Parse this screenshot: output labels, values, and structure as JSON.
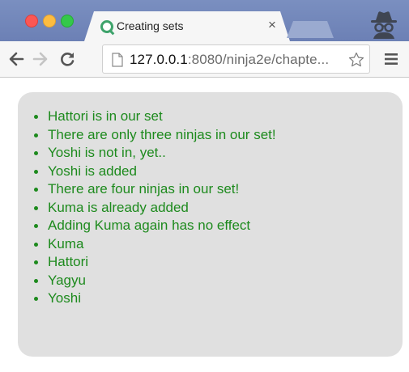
{
  "browser": {
    "tab": {
      "title": "Creating sets",
      "close_glyph": "×",
      "favicon": "loading-spinner-icon"
    },
    "url": {
      "host": "127.0.0.1",
      "rest": ":8080/ninja2e/chapte..."
    }
  },
  "page": {
    "results": [
      "Hattori is in our set",
      "There are only three ninjas in our set!",
      "Yoshi is not in, yet..",
      "Yoshi is added",
      "There are four ninjas in our set!",
      "Kuma is already added",
      "Adding Kuma again has no effect",
      "Kuma",
      "Hattori",
      "Yagyu",
      "Yoshi"
    ]
  },
  "colors": {
    "result_text": "#1d8a1d",
    "content_background": "#e0e0e0",
    "titlebar": "#7088bd"
  }
}
